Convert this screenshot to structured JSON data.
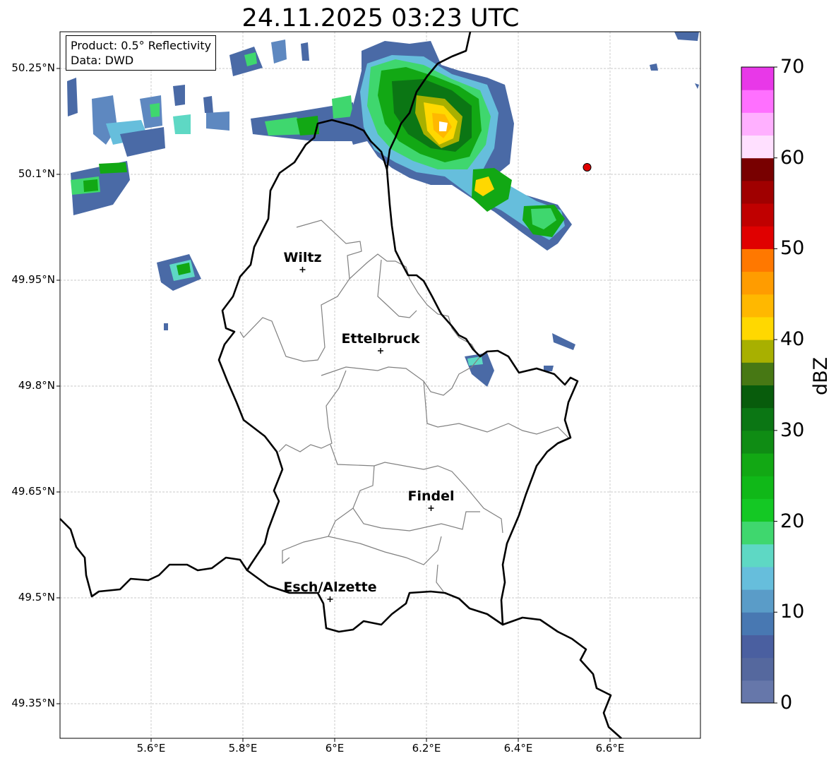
{
  "title": "24.11.2025 03:23 UTC",
  "product_box": {
    "product": "Product: 0.5° Reflectivity",
    "source": "Data: DWD"
  },
  "axes": {
    "lon_ticks": [
      "5.6°E",
      "5.8°E",
      "6°E",
      "6.2°E",
      "6.4°E",
      "6.6°E"
    ],
    "lat_ticks": [
      "50.25°N",
      "50.1°N",
      "49.95°N",
      "49.8°N",
      "49.65°N",
      "49.5°N",
      "49.35°N"
    ]
  },
  "cities": [
    {
      "name": "Wiltz",
      "lon": 5.93,
      "lat": 49.965
    },
    {
      "name": "Ettelbruck",
      "lon": 6.1,
      "lat": 49.85
    },
    {
      "name": "Findel",
      "lon": 6.21,
      "lat": 49.627
    },
    {
      "name": "Esch/Alzette",
      "lon": 5.99,
      "lat": 49.498
    }
  ],
  "radar_site": {
    "lon": 6.55,
    "lat": 50.11,
    "color": "#e00000"
  },
  "colorbar": {
    "label": "dBZ",
    "ticks": [
      "0",
      "10",
      "20",
      "30",
      "40",
      "50",
      "60",
      "70"
    ],
    "colors": [
      "#6677aa",
      "#55689e",
      "#4a5fa0",
      "#4878b2",
      "#5a9cc8",
      "#66bedc",
      "#5ed8c4",
      "#3fd76e",
      "#14c824",
      "#10b818",
      "#12a814",
      "#0f8c14",
      "#0b7614",
      "#085c0c",
      "#477814",
      "#a8b000",
      "#ffd800",
      "#ffb800",
      "#ff9c00",
      "#ff7800",
      "#e00000",
      "#c00000",
      "#a00000",
      "#780000",
      "#ffe0ff",
      "#ffb0ff",
      "#ff70ff",
      "#e838e8"
    ]
  },
  "chart_data": {
    "type": "map",
    "title": "24.11.2025 03:23 UTC",
    "xlim": [
      5.4,
      6.79
    ],
    "ylim": [
      49.3,
      50.3
    ],
    "xticks": [
      5.6,
      5.8,
      6.0,
      6.2,
      6.4,
      6.6
    ],
    "yticks": [
      49.35,
      49.5,
      49.65,
      49.8,
      49.95,
      50.1,
      50.25
    ],
    "grid": true,
    "colorbar_range": [
      0,
      70
    ],
    "colorbar_label": "dBZ",
    "markers": [
      {
        "name": "Wiltz",
        "lon": 5.93,
        "lat": 49.965
      },
      {
        "name": "Ettelbruck",
        "lon": 6.1,
        "lat": 49.85
      },
      {
        "name": "Findel",
        "lon": 6.21,
        "lat": 49.627
      },
      {
        "name": "Esch/Alzette",
        "lon": 5.99,
        "lat": 49.498
      },
      {
        "lon": 6.55,
        "lat": 50.11
      }
    ]
  }
}
